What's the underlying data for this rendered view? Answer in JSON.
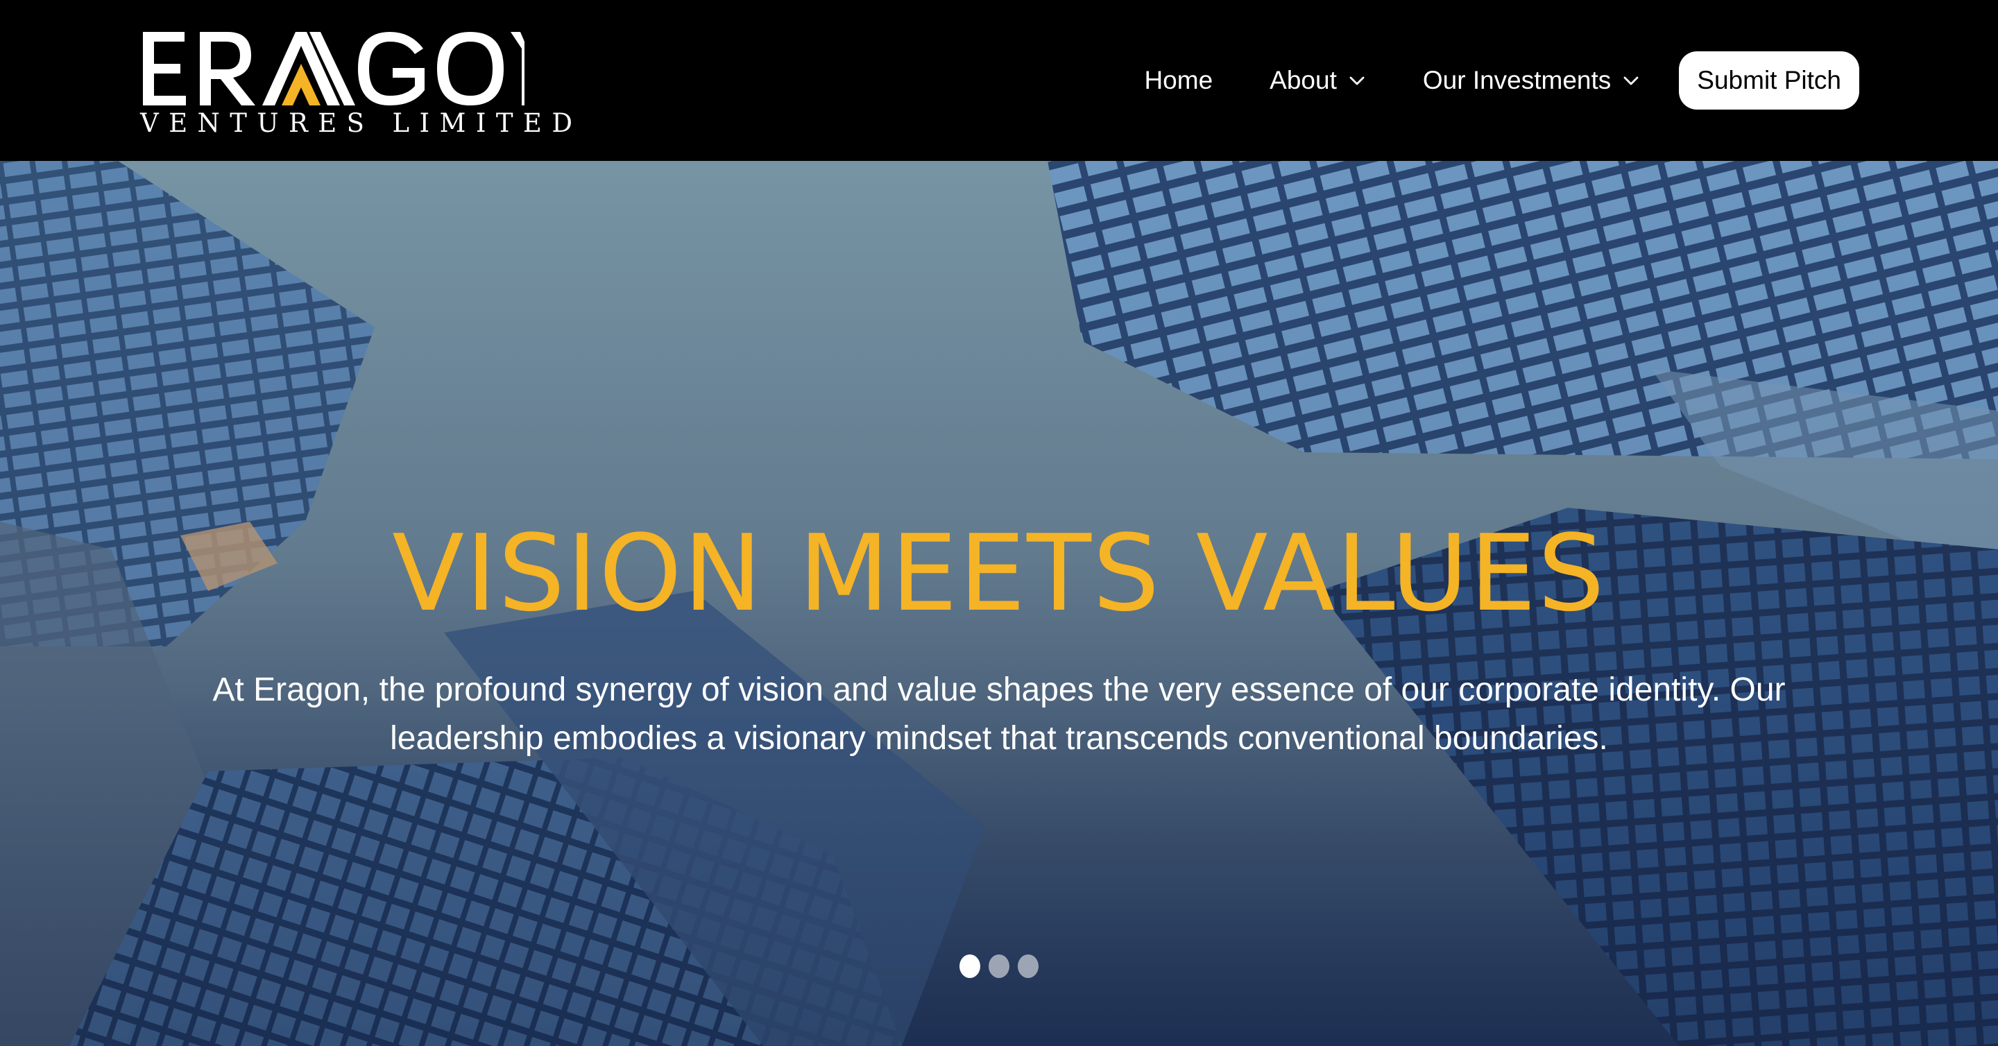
{
  "brand": {
    "name": "ERAGON",
    "tagline": "VENTURES LIMITED",
    "accent_color": "#f5b326"
  },
  "nav": {
    "items": [
      {
        "label": "Home",
        "has_dropdown": false
      },
      {
        "label": "About",
        "has_dropdown": true,
        "icon": "chevron-down-icon"
      },
      {
        "label": "Our Investments",
        "has_dropdown": true,
        "icon": "chevron-down-icon"
      }
    ],
    "cta_label": "Submit Pitch"
  },
  "hero": {
    "title": "VISION MEETS VALUES",
    "text": "At Eragon, the profound synergy of vision and value shapes the very essence of our corporate identity. Our leadership embodies a visionary mindset that transcends conventional boundaries.",
    "title_color": "#f5b326",
    "slides": {
      "count": 3,
      "active": 1
    }
  }
}
